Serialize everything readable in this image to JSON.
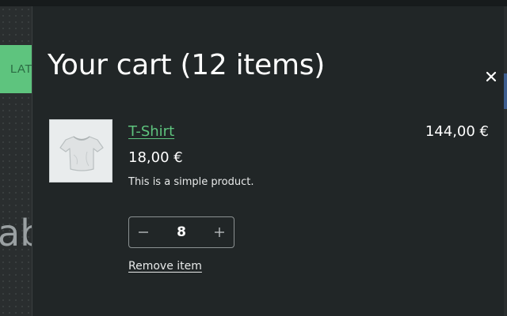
{
  "background": {
    "strip_label": "LAT",
    "big_text": "ab"
  },
  "cart": {
    "title": "Your cart (12 items)",
    "close_icon": "close-icon"
  },
  "item": {
    "name": "T-Shirt",
    "unit_price": "18,00 €",
    "description": "This is a simple product.",
    "line_total": "144,00 €",
    "quantity": "8",
    "remove_label": "Remove item",
    "thumbnail_icon": "tshirt-image"
  },
  "colors": {
    "accent": "#5ec47e",
    "drawer_bg": "#212627",
    "text": "#ffffff"
  }
}
